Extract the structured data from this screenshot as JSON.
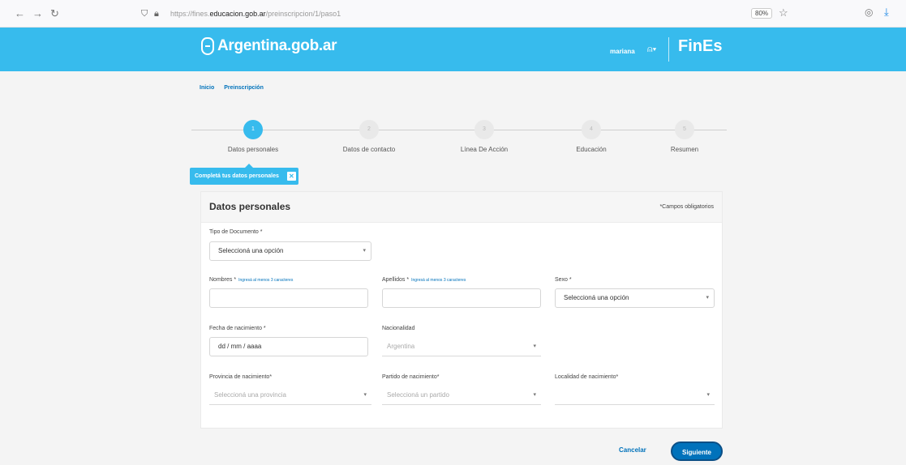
{
  "browser": {
    "back": "←",
    "forward": "→",
    "reload": "↻",
    "url_prefix": "https://fines.",
    "url_domain": "educacion.gob.ar",
    "url_path": "/preinscripcion/1/paso1",
    "zoom": "80%"
  },
  "header": {
    "logo_text": "Argentina.gob.ar",
    "user_name": "mariana",
    "brand": "FinEs"
  },
  "breadcrumb": {
    "home": "Inicio",
    "current": "Preinscripción"
  },
  "steps": [
    {
      "number": "1",
      "label": "Datos personales"
    },
    {
      "number": "2",
      "label": "Datos de contacto"
    },
    {
      "number": "3",
      "label": "Línea De Acción"
    },
    {
      "number": "4",
      "label": "Educación"
    },
    {
      "number": "5",
      "label": "Resumen"
    }
  ],
  "tooltip": {
    "text": "Completá tus datos personales",
    "close": "✕"
  },
  "form": {
    "title": "Datos personales",
    "required_note": "*Campos obligatorios",
    "tipo_documento": {
      "label": "Tipo de Documento *",
      "value": "Seleccioná una opción"
    },
    "nombres": {
      "label": "Nombres *",
      "hint": "Ingresá al menos 3 caracteres",
      "value": ""
    },
    "apellidos": {
      "label": "Apellidos *",
      "hint": "Ingresá al menos 3 caracteres",
      "value": ""
    },
    "sexo": {
      "label": "Sexo *",
      "value": "Seleccioná una opción"
    },
    "fecha_nacimiento": {
      "label": "Fecha de nacimiento *",
      "value": "dd / mm / aaaa"
    },
    "nacionalidad": {
      "label": "Nacionalidad",
      "value": "Argentina"
    },
    "provincia": {
      "label": "Provincia de nacimiento*",
      "value": "Seleccioná una provincia"
    },
    "partido": {
      "label": "Partido de nacimiento*",
      "value": "Seleccioná un partido"
    },
    "localidad": {
      "label": "Localidad de nacimiento*",
      "value": ""
    }
  },
  "actions": {
    "cancel": "Cancelar",
    "next": "Siguiente"
  },
  "colors": {
    "header_bg": "#37bbed",
    "primary": "#0072bb"
  }
}
